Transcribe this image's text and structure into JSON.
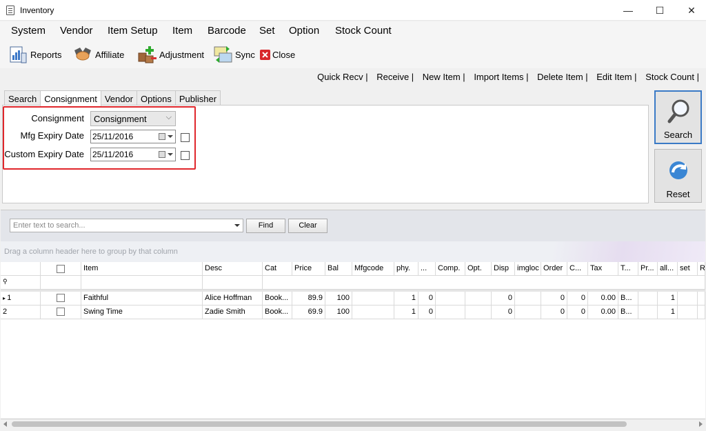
{
  "window": {
    "title": "Inventory",
    "minimize": "—",
    "maximize": "☐",
    "close": "✕"
  },
  "menu": [
    "System",
    "Vendor",
    "Item Setup",
    "Item",
    "Barcode",
    "Set",
    "Option",
    "Stock Count"
  ],
  "toolbar": {
    "reports": "Reports",
    "affiliate": "Affiliate",
    "adjustment": "Adjustment",
    "sync": "Sync",
    "close": "Close"
  },
  "quick_links": [
    "Quick Recv |",
    "Receive |",
    "New Item |",
    "Import Items |",
    "Delete Item |",
    "Edit Item |",
    "Stock Count |"
  ],
  "tabs": [
    "Search",
    "Consignment",
    "Vendor",
    "Options",
    "Publisher"
  ],
  "form": {
    "consignment_label": "Consignment",
    "consignment_value": "Consignment",
    "mfg_label": "Mfg Expiry Date",
    "mfg_value": "25/11/2016",
    "custom_label": "Custom Expiry Date",
    "custom_value": "25/11/2016"
  },
  "buttons": {
    "search": "Search",
    "reset": "Reset"
  },
  "grid_search": {
    "placeholder": "Enter text to search...",
    "find": "Find",
    "clear": "Clear"
  },
  "group_hint": "Drag a column header here to group by that column",
  "columns": [
    "Item",
    "Desc",
    "Cat",
    "Price",
    "Bal",
    "Mfgcode",
    "phy.",
    "...",
    "Comp.",
    "Opt.",
    "Disp",
    "imgloc",
    "Order",
    "C...",
    "Tax",
    "T...",
    "Pr...",
    "all...",
    "set",
    "R"
  ],
  "rows": [
    {
      "n": "1",
      "item": "Faithful",
      "desc": "Alice Hoffman",
      "cat": "Book...",
      "price": "89.9",
      "bal": "100",
      "mfg": "",
      "phy": "1",
      "dots": "0",
      "comp": "",
      "opt": "",
      "disp": "0",
      "imgloc": "",
      "order": "0",
      "c": "0",
      "tax": "0.00",
      "t": "B...",
      "pr": "",
      "all": "1",
      "set": ""
    },
    {
      "n": "2",
      "item": "Swing Time",
      "desc": "Zadie Smith",
      "cat": "Book...",
      "price": "69.9",
      "bal": "100",
      "mfg": "",
      "phy": "1",
      "dots": "0",
      "comp": "",
      "opt": "",
      "disp": "0",
      "imgloc": "",
      "order": "0",
      "c": "0",
      "tax": "0.00",
      "t": "B...",
      "pr": "",
      "all": "1",
      "set": ""
    }
  ]
}
